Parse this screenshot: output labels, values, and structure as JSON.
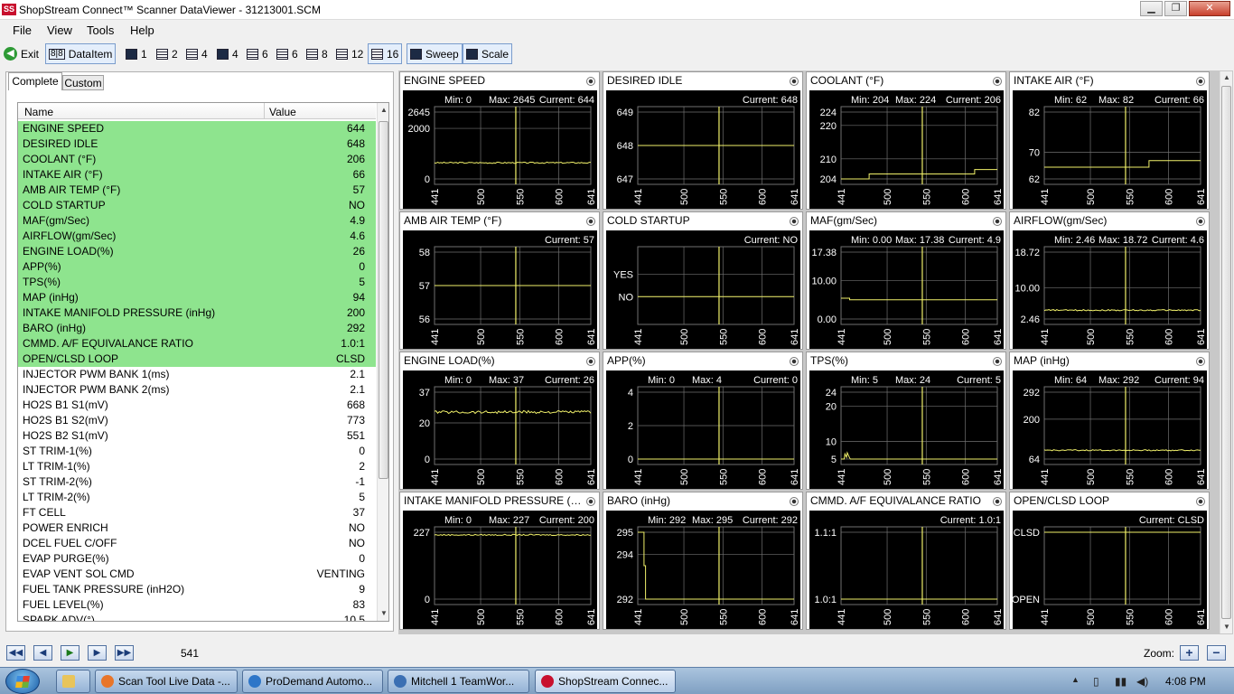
{
  "window": {
    "logo": "SS",
    "title": "ShopStream Connect™ Scanner DataViewer - 31213001.SCM",
    "minimize": "▁",
    "restore": "❐",
    "close": "✕"
  },
  "menu": [
    "File",
    "View",
    "Tools",
    "Help"
  ],
  "toolbar": {
    "exit": "Exit",
    "dataitem": "DataItem",
    "layouts": [
      "1",
      "2",
      "4",
      "4",
      "6",
      "6",
      "8",
      "12",
      "16"
    ],
    "sweep": "Sweep",
    "scale": "Scale"
  },
  "tabs": {
    "complete": "Complete",
    "custom": "Custom"
  },
  "list": {
    "header_name": "Name",
    "header_value": "Value",
    "rows": [
      {
        "name": "ENGINE SPEED",
        "value": "644",
        "hl": true
      },
      {
        "name": "DESIRED IDLE",
        "value": "648",
        "hl": true
      },
      {
        "name": "COOLANT (°F)",
        "value": "206",
        "hl": true
      },
      {
        "name": "INTAKE AIR (°F)",
        "value": "66",
        "hl": true
      },
      {
        "name": "AMB AIR TEMP (°F)",
        "value": "57",
        "hl": true
      },
      {
        "name": "COLD STARTUP",
        "value": "NO",
        "hl": true
      },
      {
        "name": "MAF(gm/Sec)",
        "value": "4.9",
        "hl": true
      },
      {
        "name": "AIRFLOW(gm/Sec)",
        "value": "4.6",
        "hl": true
      },
      {
        "name": "ENGINE LOAD(%)",
        "value": "26",
        "hl": true
      },
      {
        "name": "APP(%)",
        "value": "0",
        "hl": true
      },
      {
        "name": "TPS(%)",
        "value": "5",
        "hl": true
      },
      {
        "name": "MAP (inHg)",
        "value": "94",
        "hl": true
      },
      {
        "name": "INTAKE MANIFOLD PRESSURE (inHg)",
        "value": "200",
        "hl": true
      },
      {
        "name": "BARO (inHg)",
        "value": "292",
        "hl": true
      },
      {
        "name": "CMMD. A/F EQUIVALANCE RATIO",
        "value": "1.0:1",
        "hl": true
      },
      {
        "name": "OPEN/CLSD LOOP",
        "value": "CLSD",
        "hl": true
      },
      {
        "name": "INJECTOR PWM BANK 1(ms)",
        "value": "2.1",
        "hl": false
      },
      {
        "name": "INJECTOR PWM BANK 2(ms)",
        "value": "2.1",
        "hl": false
      },
      {
        "name": "HO2S B1 S1(mV)",
        "value": "668",
        "hl": false
      },
      {
        "name": "HO2S B1 S2(mV)",
        "value": "773",
        "hl": false
      },
      {
        "name": "HO2S B2 S1(mV)",
        "value": "551",
        "hl": false
      },
      {
        "name": "ST TRIM-1(%)",
        "value": "0",
        "hl": false
      },
      {
        "name": "LT TRIM-1(%)",
        "value": "2",
        "hl": false
      },
      {
        "name": "ST TRIM-2(%)",
        "value": "-1",
        "hl": false
      },
      {
        "name": "LT TRIM-2(%)",
        "value": "5",
        "hl": false
      },
      {
        "name": "FT CELL",
        "value": "37",
        "hl": false
      },
      {
        "name": "POWER ENRICH",
        "value": "NO",
        "hl": false
      },
      {
        "name": "DCEL FUEL C/OFF",
        "value": "NO",
        "hl": false
      },
      {
        "name": "EVAP PURGE(%)",
        "value": "0",
        "hl": false
      },
      {
        "name": "EVAP VENT SOL CMD",
        "value": "VENTING",
        "hl": false
      },
      {
        "name": "FUEL TANK PRESSURE  (inH2O)",
        "value": "9",
        "hl": false
      },
      {
        "name": "FUEL LEVEL(%)",
        "value": "83",
        "hl": false
      },
      {
        "name": "SPARK ADV(°)",
        "value": "10.5",
        "hl": false
      }
    ]
  },
  "chart_data": [
    {
      "type": "line",
      "title": "ENGINE SPEED",
      "stats": {
        "min": "Min: 0",
        "max": "Max: 2645",
        "current": "Current: 644"
      },
      "xlim": [
        441,
        641
      ],
      "xticks": [
        "441",
        "500",
        "550",
        "600",
        "641"
      ],
      "ylim": [
        0,
        2645
      ],
      "yticks": [
        {
          "v": 2645,
          "t": "2645"
        },
        {
          "v": 2000,
          "t": "2000"
        },
        {
          "v": 0,
          "t": "0"
        }
      ],
      "cursor": 545,
      "series": [
        {
          "x": [
            441,
            641
          ],
          "y": [
            640,
            640
          ]
        }
      ],
      "noise": 25
    },
    {
      "type": "line",
      "title": "DESIRED IDLE",
      "stats": {
        "min": "",
        "max": "",
        "current": "Current: 648"
      },
      "xlim": [
        441,
        641
      ],
      "xticks": [
        "441",
        "500",
        "550",
        "600",
        "641"
      ],
      "ylim": [
        647,
        649
      ],
      "yticks": [
        {
          "v": 649,
          "t": "649"
        },
        {
          "v": 648,
          "t": "648"
        },
        {
          "v": 647,
          "t": "647"
        }
      ],
      "cursor": 545,
      "series": [
        {
          "x": [
            441,
            641
          ],
          "y": [
            648,
            648
          ]
        }
      ]
    },
    {
      "type": "line",
      "title": "COOLANT (°F)",
      "stats": {
        "min": "Min: 204",
        "max": "Max: 224",
        "current": "Current: 206"
      },
      "xlim": [
        441,
        641
      ],
      "xticks": [
        "441",
        "500",
        "550",
        "600",
        "641"
      ],
      "ylim": [
        204,
        224
      ],
      "yticks": [
        {
          "v": 224,
          "t": "224"
        },
        {
          "v": 220,
          "t": "220"
        },
        {
          "v": 210,
          "t": "210"
        },
        {
          "v": 204,
          "t": "204"
        }
      ],
      "cursor": 545,
      "series": [
        {
          "x": [
            441,
            477,
            477,
            612,
            612,
            641
          ],
          "y": [
            204,
            204,
            205.5,
            205.5,
            206.8,
            206.8
          ]
        }
      ]
    },
    {
      "type": "line",
      "title": "INTAKE AIR (°F)",
      "stats": {
        "min": "Min: 62",
        "max": "Max: 82",
        "current": "Current: 66"
      },
      "xlim": [
        441,
        641
      ],
      "xticks": [
        "441",
        "500",
        "550",
        "600",
        "641"
      ],
      "ylim": [
        62,
        82
      ],
      "yticks": [
        {
          "v": 82,
          "t": "82"
        },
        {
          "v": 70,
          "t": "70"
        },
        {
          "v": 62,
          "t": "62"
        }
      ],
      "cursor": 545,
      "series": [
        {
          "x": [
            441,
            575,
            575,
            641
          ],
          "y": [
            65.5,
            65.5,
            67.5,
            67.5
          ]
        }
      ]
    },
    {
      "type": "line",
      "title": "AMB AIR TEMP (°F)",
      "stats": {
        "min": "",
        "max": "",
        "current": "Current: 57"
      },
      "xlim": [
        441,
        641
      ],
      "xticks": [
        "441",
        "500",
        "550",
        "600",
        "641"
      ],
      "ylim": [
        56,
        58
      ],
      "yticks": [
        {
          "v": 58,
          "t": "58"
        },
        {
          "v": 57,
          "t": "57"
        },
        {
          "v": 56,
          "t": "56"
        }
      ],
      "cursor": 545,
      "series": [
        {
          "x": [
            441,
            641
          ],
          "y": [
            57,
            57
          ]
        }
      ]
    },
    {
      "type": "line",
      "title": "COLD STARTUP",
      "stats": {
        "min": "",
        "max": "",
        "current": "Current: NO"
      },
      "xlim": [
        441,
        641
      ],
      "xticks": [
        "441",
        "500",
        "550",
        "600",
        "641"
      ],
      "ylim": [
        -1,
        2
      ],
      "yticks": [
        {
          "v": 1,
          "t": "YES"
        },
        {
          "v": 0,
          "t": "NO"
        }
      ],
      "cursor": 545,
      "series": [
        {
          "x": [
            441,
            641
          ],
          "y": [
            0,
            0
          ]
        }
      ]
    },
    {
      "type": "line",
      "title": "MAF(gm/Sec)",
      "stats": {
        "min": "Min: 0.00",
        "max": "Max: 17.38",
        "current": "Current: 4.9"
      },
      "xlim": [
        441,
        641
      ],
      "xticks": [
        "441",
        "500",
        "550",
        "600",
        "641"
      ],
      "ylim": [
        0,
        17.38
      ],
      "yticks": [
        {
          "v": 17.38,
          "t": "17.38"
        },
        {
          "v": 10,
          "t": "10.00"
        },
        {
          "v": 0,
          "t": "0.00"
        }
      ],
      "cursor": 545,
      "series": [
        {
          "x": [
            441,
            452,
            452,
            641
          ],
          "y": [
            5.4,
            5.4,
            5.0,
            5.0
          ]
        }
      ]
    },
    {
      "type": "line",
      "title": "AIRFLOW(gm/Sec)",
      "stats": {
        "min": "Min: 2.46",
        "max": "Max: 18.72",
        "current": "Current: 4.6"
      },
      "xlim": [
        441,
        641
      ],
      "xticks": [
        "441",
        "500",
        "550",
        "600",
        "641"
      ],
      "ylim": [
        2.46,
        18.72
      ],
      "yticks": [
        {
          "v": 18.72,
          "t": "18.72"
        },
        {
          "v": 10,
          "t": "10.00"
        },
        {
          "v": 2.46,
          "t": "2.46"
        }
      ],
      "cursor": 545,
      "series": [
        {
          "x": [
            441,
            641
          ],
          "y": [
            4.6,
            4.6
          ]
        }
      ],
      "noise": 0.15
    },
    {
      "type": "line",
      "title": "ENGINE LOAD(%)",
      "stats": {
        "min": "Min: 0",
        "max": "Max: 37",
        "current": "Current: 26"
      },
      "xlim": [
        441,
        641
      ],
      "xticks": [
        "441",
        "500",
        "550",
        "600",
        "641"
      ],
      "ylim": [
        0,
        37
      ],
      "yticks": [
        {
          "v": 37,
          "t": "37"
        },
        {
          "v": 20,
          "t": "20"
        },
        {
          "v": 0,
          "t": "0"
        }
      ],
      "cursor": 545,
      "series": [
        {
          "x": [
            441,
            641
          ],
          "y": [
            26,
            26
          ]
        }
      ],
      "noise": 0.8
    },
    {
      "type": "line",
      "title": "APP(%)",
      "stats": {
        "min": "Min: 0",
        "max": "Max: 4",
        "current": "Current: 0"
      },
      "xlim": [
        441,
        641
      ],
      "xticks": [
        "441",
        "500",
        "550",
        "600",
        "641"
      ],
      "ylim": [
        0,
        4
      ],
      "yticks": [
        {
          "v": 4,
          "t": "4"
        },
        {
          "v": 2,
          "t": "2"
        },
        {
          "v": 0,
          "t": "0"
        }
      ],
      "cursor": 545,
      "series": [
        {
          "x": [
            441,
            641
          ],
          "y": [
            0,
            0
          ]
        }
      ]
    },
    {
      "type": "line",
      "title": "TPS(%)",
      "stats": {
        "min": "Min: 5",
        "max": "Max: 24",
        "current": "Current: 5"
      },
      "xlim": [
        441,
        641
      ],
      "xticks": [
        "441",
        "500",
        "550",
        "600",
        "641"
      ],
      "ylim": [
        5,
        24
      ],
      "yticks": [
        {
          "v": 24,
          "t": "24"
        },
        {
          "v": 20,
          "t": "20"
        },
        {
          "v": 10,
          "t": "10"
        },
        {
          "v": 5,
          "t": "5"
        }
      ],
      "cursor": 545,
      "series": [
        {
          "x": [
            441,
            445,
            446,
            448,
            449,
            452,
            453,
            641
          ],
          "y": [
            5,
            5,
            6.5,
            5.5,
            6.8,
            5.3,
            5,
            5
          ]
        }
      ]
    },
    {
      "type": "line",
      "title": "MAP (inHg)",
      "stats": {
        "min": "Min: 64",
        "max": "Max: 292",
        "current": "Current: 94"
      },
      "xlim": [
        441,
        641
      ],
      "xticks": [
        "441",
        "500",
        "550",
        "600",
        "641"
      ],
      "ylim": [
        64,
        292
      ],
      "yticks": [
        {
          "v": 292,
          "t": "292"
        },
        {
          "v": 200,
          "t": "200"
        },
        {
          "v": 64,
          "t": "64"
        }
      ],
      "cursor": 545,
      "series": [
        {
          "x": [
            441,
            641
          ],
          "y": [
            94,
            94
          ]
        }
      ],
      "noise": 2
    },
    {
      "type": "line",
      "title": "INTAKE MANIFOLD PRESSURE (inHg)",
      "stats": {
        "min": "Min: 0",
        "max": "Max: 227",
        "current": "Current: 200"
      },
      "xlim": [
        441,
        641
      ],
      "xticks": [
        "441",
        "500",
        "550",
        "600",
        "641"
      ],
      "ylim": [
        0,
        227
      ],
      "yticks": [
        {
          "v": 227,
          "t": "227"
        },
        {
          "v": 0,
          "t": "0"
        }
      ],
      "cursor": 545,
      "series": [
        {
          "x": [
            441,
            641
          ],
          "y": [
            218,
            218
          ]
        }
      ],
      "noise": 2
    },
    {
      "type": "line",
      "title": "BARO (inHg)",
      "stats": {
        "min": "Min: 292",
        "max": "Max: 295",
        "current": "Current: 292"
      },
      "xlim": [
        441,
        641
      ],
      "xticks": [
        "441",
        "500",
        "550",
        "600",
        "641"
      ],
      "ylim": [
        292,
        295
      ],
      "yticks": [
        {
          "v": 295,
          "t": "295"
        },
        {
          "v": 294,
          "t": "294"
        },
        {
          "v": 292,
          "t": "292"
        }
      ],
      "cursor": 545,
      "series": [
        {
          "x": [
            441,
            449,
            449,
            451,
            451,
            641
          ],
          "y": [
            295,
            295,
            293.5,
            293.5,
            292,
            292
          ]
        }
      ]
    },
    {
      "type": "line",
      "title": "CMMD. A/F EQUIVALANCE RATIO",
      "stats": {
        "min": "",
        "max": "",
        "current": "Current: 1.0:1"
      },
      "xlim": [
        441,
        641
      ],
      "xticks": [
        "441",
        "500",
        "550",
        "600",
        "641"
      ],
      "ylim": [
        1.0,
        1.1
      ],
      "yticks": [
        {
          "v": 1.1,
          "t": "1.1:1"
        },
        {
          "v": 1.0,
          "t": "1.0:1"
        }
      ],
      "cursor": 545,
      "series": [
        {
          "x": [
            441,
            641
          ],
          "y": [
            1.0,
            1.0
          ]
        }
      ]
    },
    {
      "type": "line",
      "title": "OPEN/CLSD LOOP",
      "stats": {
        "min": "",
        "max": "",
        "current": "Current: CLSD"
      },
      "xlim": [
        441,
        641
      ],
      "xticks": [
        "441",
        "500",
        "550",
        "600",
        "641"
      ],
      "ylim": [
        0,
        1
      ],
      "yticks": [
        {
          "v": 1,
          "t": "CLSD"
        },
        {
          "v": 0,
          "t": "OPEN"
        }
      ],
      "cursor": 545,
      "series": [
        {
          "x": [
            441,
            641
          ],
          "y": [
            1,
            1
          ]
        }
      ]
    }
  ],
  "navigation": {
    "frame": "541",
    "zoom_label": "Zoom:",
    "zoom_in": "+",
    "zoom_out": "−",
    "first": "◀◀",
    "prev": "◀",
    "play": "▶",
    "next": "▶",
    "last": "▶▶"
  },
  "taskbar": {
    "items": [
      {
        "label": "Scan Tool Live Data -...",
        "icon_color": "#e8752a"
      },
      {
        "label": "ProDemand Automo...",
        "icon_color": "#2e76c8"
      },
      {
        "label": "Mitchell 1 TeamWor...",
        "icon_color": "#3b6fb3"
      },
      {
        "label": "ShopStream Connec...",
        "icon_color": "#c8102e"
      }
    ],
    "tray_arrow": "▲",
    "tray_signal": "▮▮",
    "tray_volume": "◀)",
    "clock": "4:08 PM"
  },
  "colors": {
    "trace": "#f0f06a",
    "highlight": "#8ee48e",
    "plot_bg": "#000000",
    "grid": "#707070"
  }
}
